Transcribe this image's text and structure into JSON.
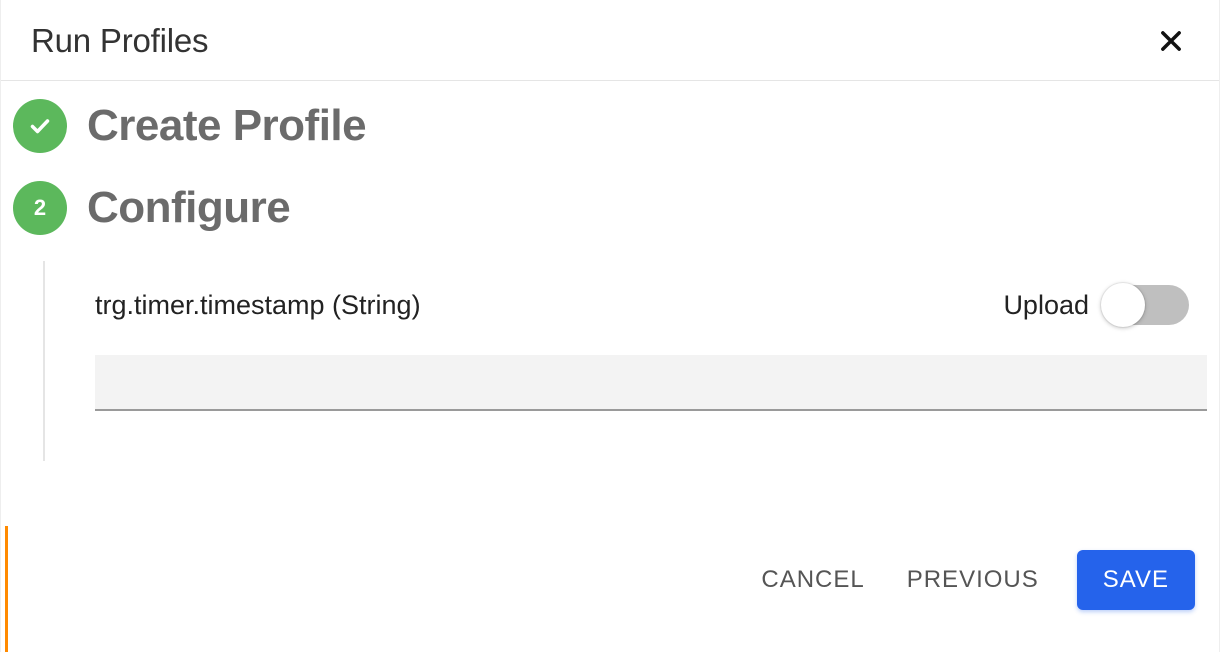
{
  "header": {
    "title": "Run Profiles"
  },
  "steps": [
    {
      "label": "Create Profile",
      "badge": "check"
    },
    {
      "label": "Configure",
      "badge": "2"
    }
  ],
  "configure": {
    "field_label": "trg.timer.timestamp (String)",
    "upload_label": "Upload",
    "upload_on": false,
    "input_value": ""
  },
  "footer": {
    "cancel": "CANCEL",
    "previous": "PREVIOUS",
    "save": "SAVE"
  }
}
